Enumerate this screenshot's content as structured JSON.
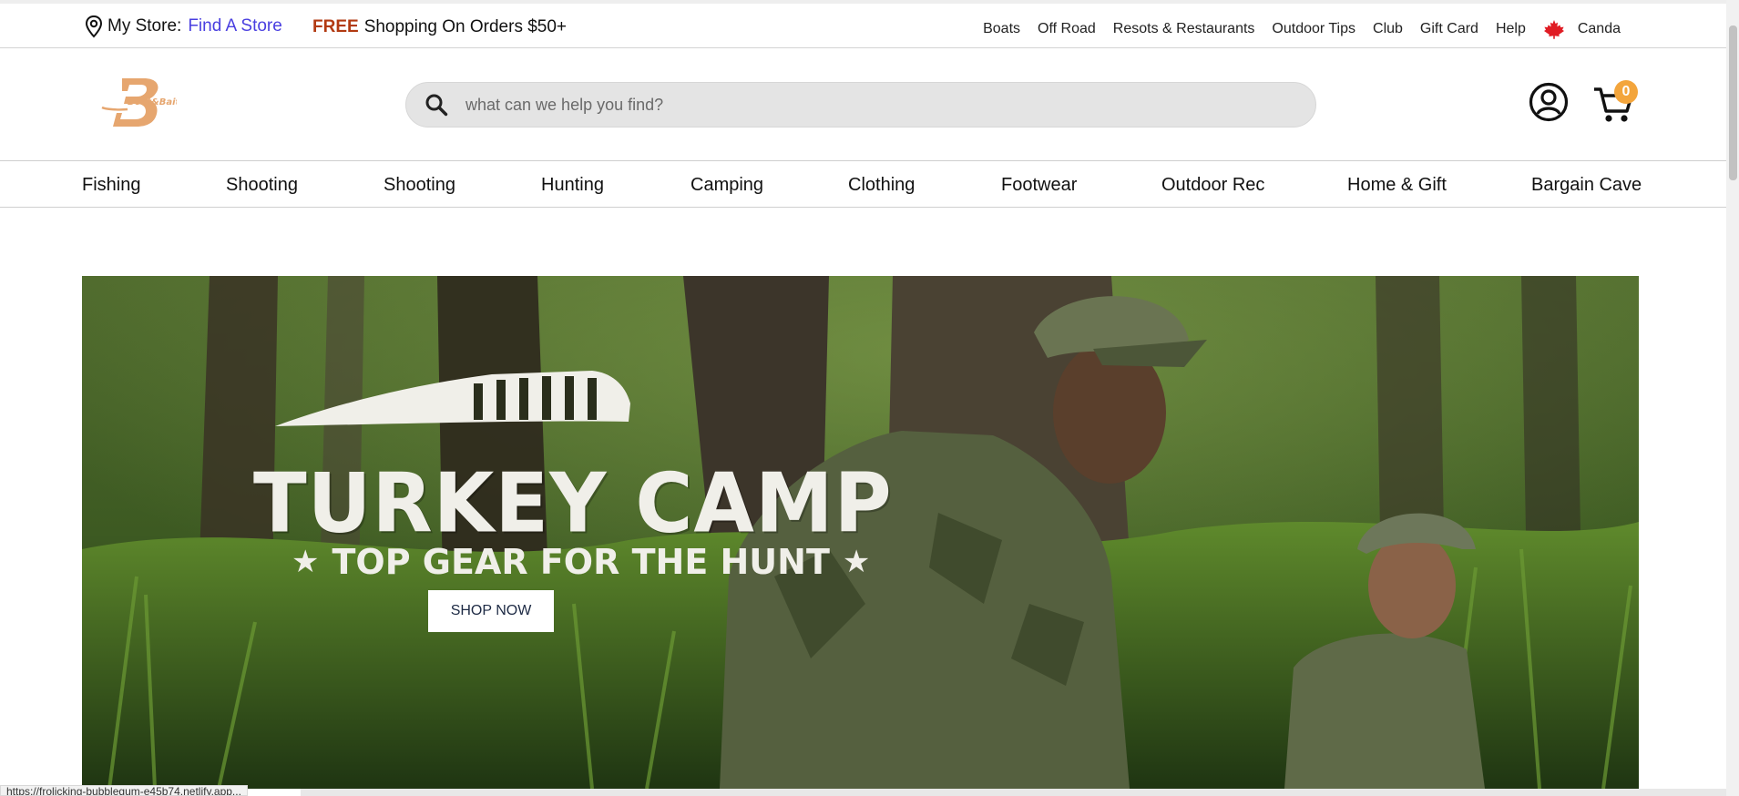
{
  "topbar": {
    "my_store_label": "My Store:",
    "find_store_link": "Find A Store",
    "promo_free": "FREE",
    "promo_text": "Shopping On Orders $50+",
    "links": [
      "Boats",
      "Off Road",
      "Resots & Restaurants",
      "Outdoor Tips",
      "Club",
      "Gift Card",
      "Help"
    ],
    "country": "Canda"
  },
  "header": {
    "logo_text": "Boat&Bait",
    "search_placeholder": "what can we help you find?",
    "cart_count": "0"
  },
  "nav": {
    "categories": [
      "Fishing",
      "Shooting",
      "Shooting",
      "Hunting",
      "Camping",
      "Clothing",
      "Footwear",
      "Outdoor Rec",
      "Home & Gift",
      "Bargain Cave"
    ]
  },
  "hero": {
    "title": "TURKEY CAMP",
    "subtitle": "TOP GEAR FOR THE HUNT",
    "star": "★",
    "cta": "SHOP NOW"
  },
  "status": {
    "url": "https://frolicking-bubblegum-e45b74.netlify.app..."
  },
  "colors": {
    "find_store_link": "#4a3fe0",
    "free_text": "#b23a12",
    "cart_badge": "#f3a53c",
    "logo": "#e6a66f",
    "search_bg": "#e4e4e4"
  }
}
